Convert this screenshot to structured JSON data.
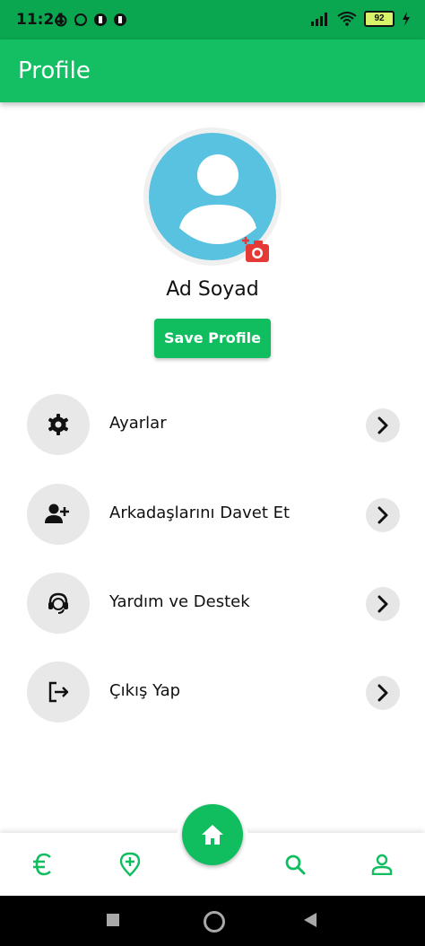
{
  "status_bar": {
    "time": "11:24",
    "battery": "92"
  },
  "app_bar": {
    "title": "Profile"
  },
  "profile": {
    "name": "Ad Soyad",
    "save_label": "Save Profile"
  },
  "menu": [
    {
      "label": "Ayarlar",
      "icon": "gear-icon"
    },
    {
      "label": "Arkadaşlarını Davet Et",
      "icon": "add-user-icon"
    },
    {
      "label": "Yardım ve Destek",
      "icon": "headset-icon"
    },
    {
      "label": "Çıkış Yap",
      "icon": "logout-icon"
    }
  ],
  "bottom_nav": [
    {
      "icon": "euro-icon"
    },
    {
      "icon": "location-add-icon"
    },
    {
      "icon": "home-icon"
    },
    {
      "icon": "search-icon"
    },
    {
      "icon": "user-icon"
    }
  ],
  "colors": {
    "primary": "#14bf63",
    "status_bar": "#0aa650",
    "avatar": "#58c2e0",
    "camera": "#e53935"
  }
}
